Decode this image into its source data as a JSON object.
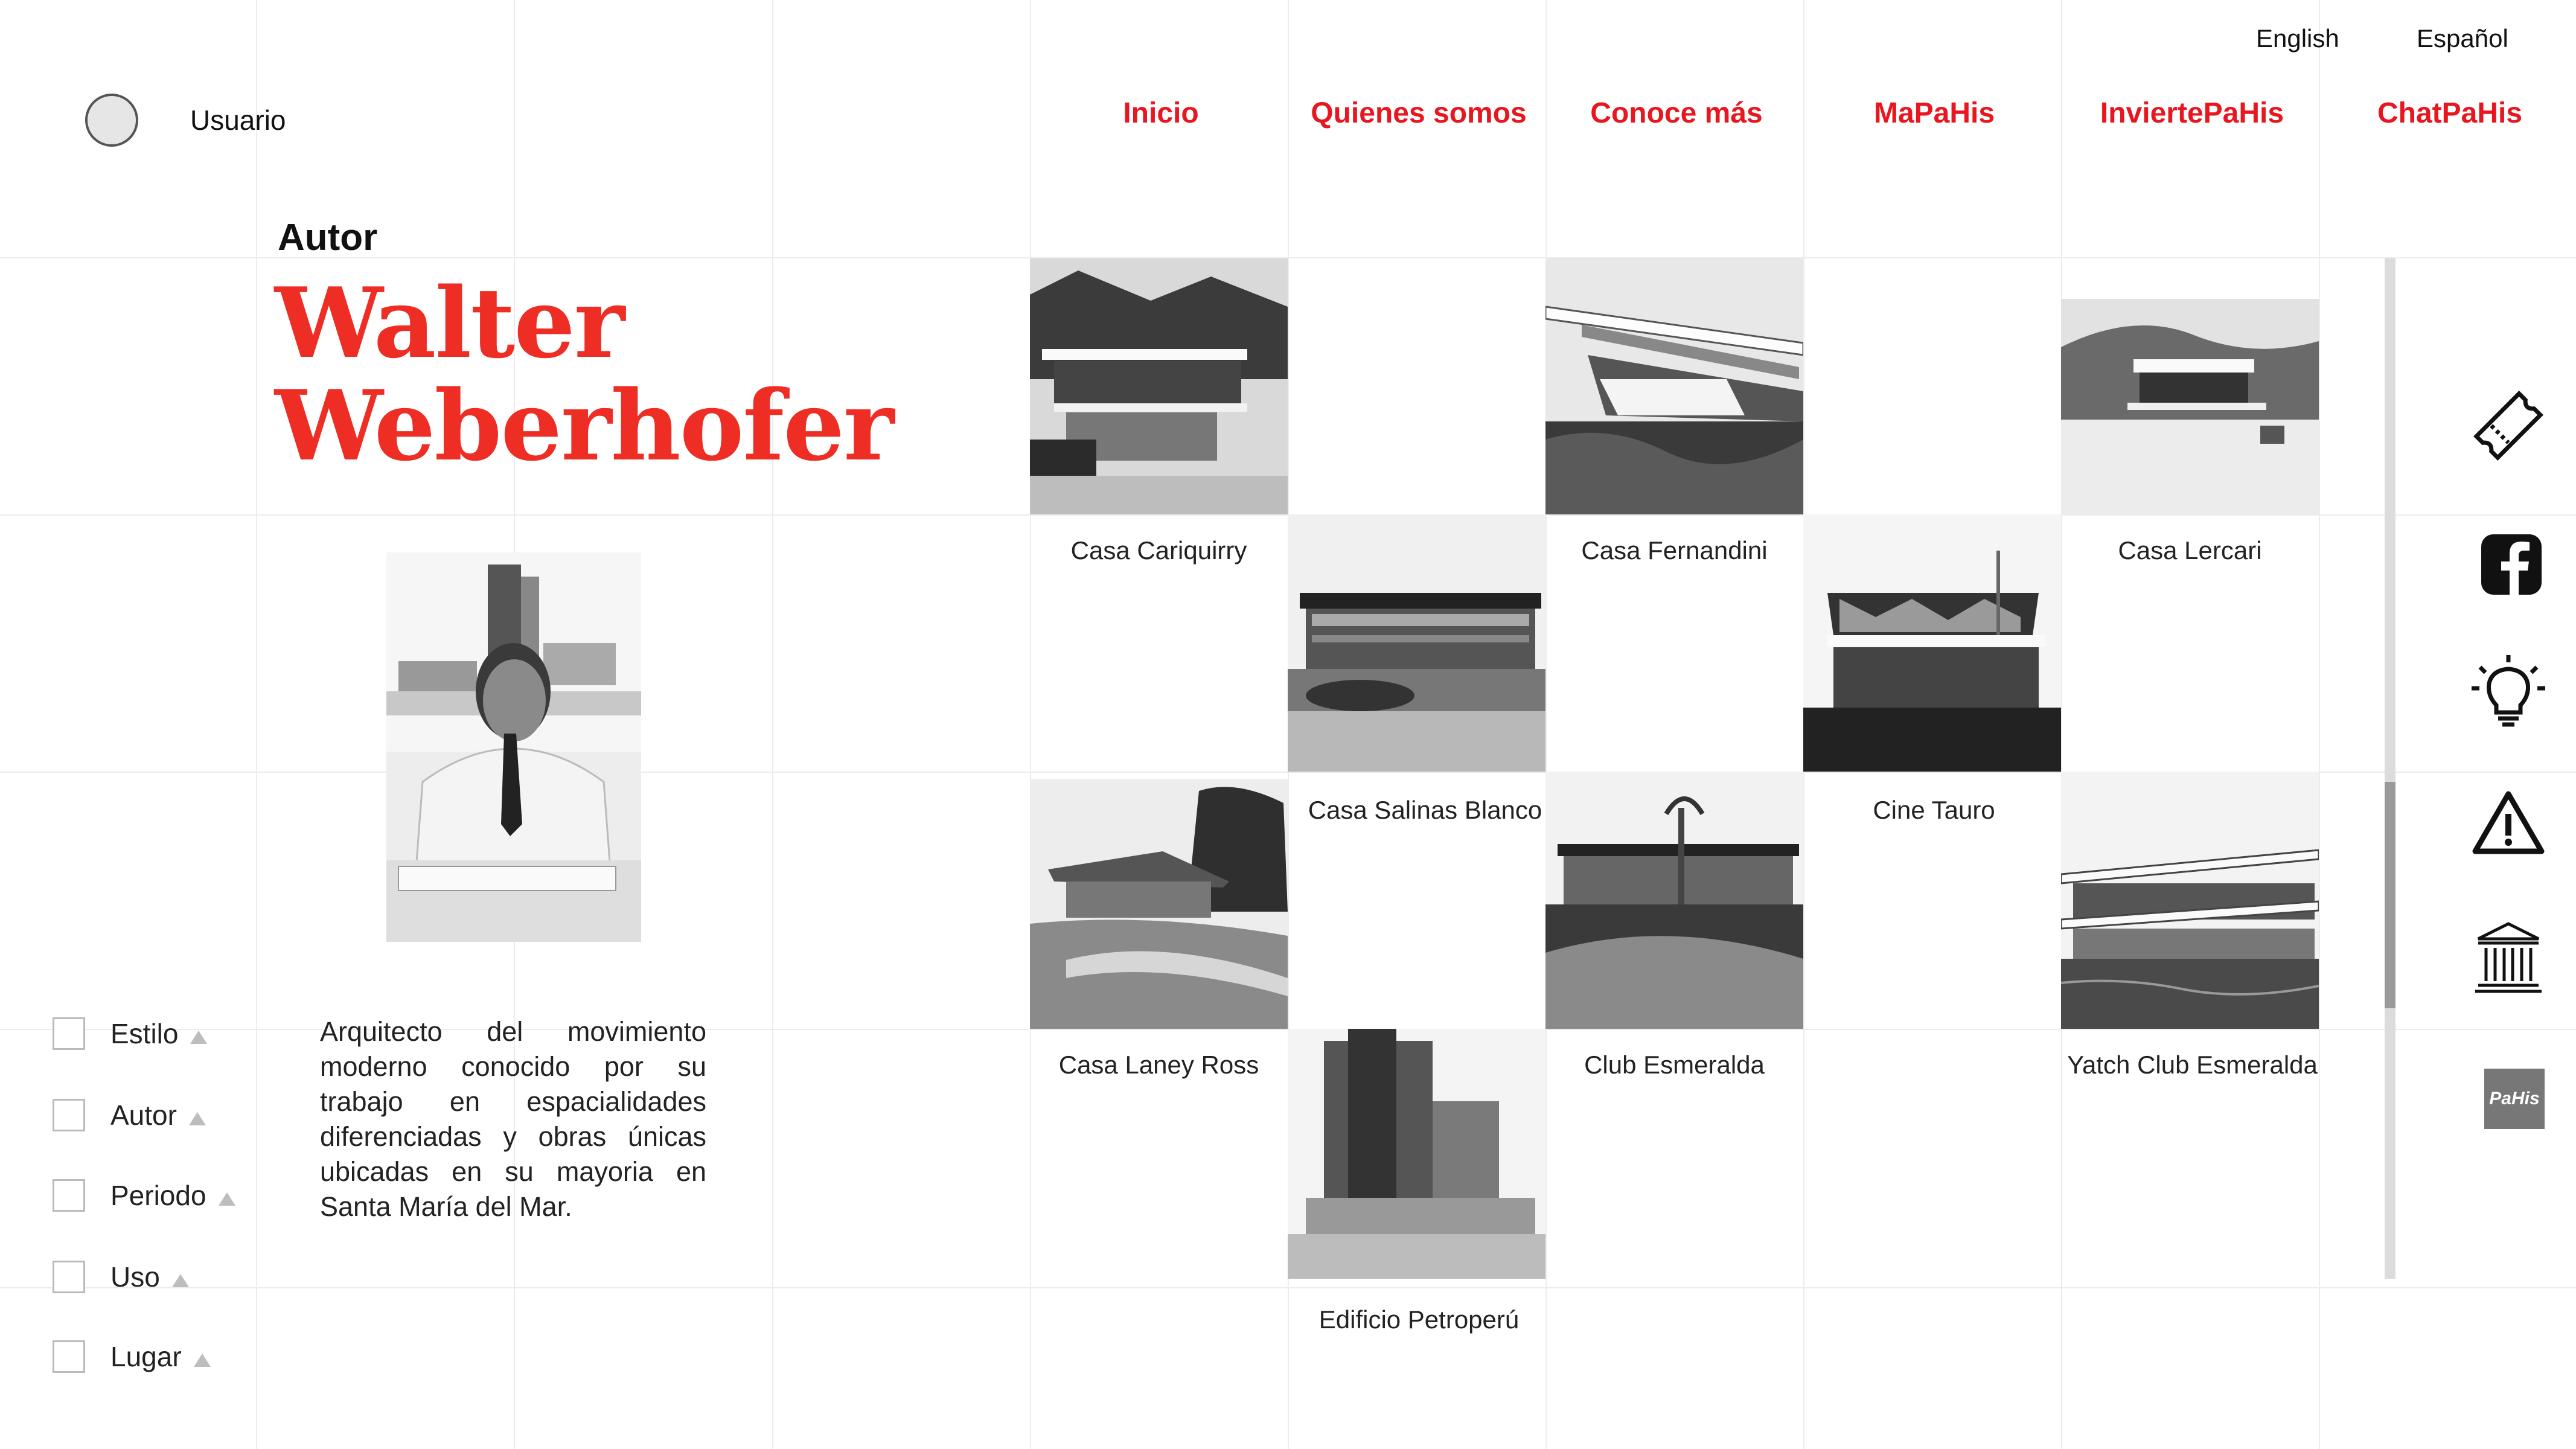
{
  "user": {
    "label": "Usuario"
  },
  "languages": [
    "English",
    "Español"
  ],
  "nav": [
    "Inicio",
    "Quienes somos",
    "Conoce más",
    "MaPaHis",
    "InviertePaHis",
    "ChatPaHis"
  ],
  "author": {
    "kicker": "Autor",
    "first_name": "Walter",
    "last_name": "Weberhofer",
    "description": "Arquitecto del movimiento moderno conocido por su trabajo en espacialidades diferenciadas y obras únicas ubicadas en su mayoria en Santa María del Mar."
  },
  "filters": [
    "Estilo",
    "Autor",
    "Periodo",
    "Uso",
    "Lugar"
  ],
  "projects": [
    "Casa Cariquirry",
    "Casa Fernandini",
    "Casa Lercari",
    "Casa Salinas Blanco",
    "Cine Tauro",
    "Casa Laney Ross",
    "Club Esmeralda",
    "Yatch Club Esmeralda",
    "Edificio Petroperú"
  ],
  "rail_icons": [
    "ticket-icon",
    "facebook-icon",
    "lightbulb-icon",
    "warning-icon",
    "museum-icon",
    "pahis-logo-icon"
  ],
  "badge": {
    "text": "PaHis"
  },
  "colors": {
    "accent": "#e8161e",
    "author_name": "#ee2e24",
    "grid": "#ececec"
  }
}
